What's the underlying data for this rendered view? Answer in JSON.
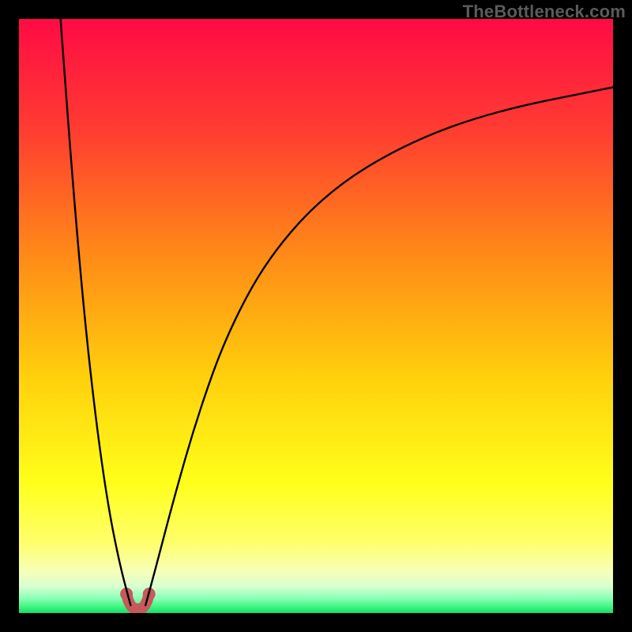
{
  "attribution": "TheBottleneck.com",
  "chart_data": {
    "type": "line",
    "title": "",
    "xlabel": "",
    "ylabel": "",
    "xlim": [
      0,
      100
    ],
    "ylim": [
      0,
      100
    ],
    "grid": false,
    "legend": false,
    "background_gradient_stops": [
      {
        "offset": 0.0,
        "color": "#ff0b44"
      },
      {
        "offset": 0.18,
        "color": "#ff3a32"
      },
      {
        "offset": 0.4,
        "color": "#ff8b17"
      },
      {
        "offset": 0.6,
        "color": "#ffcf0c"
      },
      {
        "offset": 0.78,
        "color": "#ffff1a"
      },
      {
        "offset": 0.88,
        "color": "#ffff6a"
      },
      {
        "offset": 0.93,
        "color": "#f6ffb8"
      },
      {
        "offset": 0.955,
        "color": "#d9ffd0"
      },
      {
        "offset": 0.975,
        "color": "#8cffb8"
      },
      {
        "offset": 0.99,
        "color": "#3cf57e"
      },
      {
        "offset": 1.0,
        "color": "#13df6a"
      }
    ],
    "series": [
      {
        "name": "bottleneck-curve-left",
        "stroke": "#000000",
        "x": [
          7.0,
          9.0,
          11.0,
          13.0,
          15.0,
          17.0,
          18.8
        ],
        "y": [
          100.0,
          73.0,
          50.0,
          32.0,
          18.0,
          8.0,
          1.3
        ]
      },
      {
        "name": "bottleneck-curve-right",
        "stroke": "#000000",
        "x": [
          21.3,
          23.0,
          26.0,
          30.0,
          35.0,
          42.0,
          52.0,
          65.0,
          80.0,
          100.0
        ],
        "y": [
          1.3,
          7.5,
          19.0,
          33.0,
          47.0,
          60.0,
          71.0,
          79.0,
          84.5,
          88.5
        ]
      },
      {
        "name": "valley-floor-marker",
        "stroke": "#c65a5a",
        "x": [
          18.1,
          18.4,
          18.8,
          19.2,
          19.7,
          20.3,
          20.8,
          21.2,
          21.6,
          21.9
        ],
        "y": [
          3.2,
          2.1,
          1.3,
          0.85,
          0.7,
          0.7,
          0.85,
          1.3,
          2.1,
          3.2
        ]
      }
    ],
    "annotations": []
  }
}
